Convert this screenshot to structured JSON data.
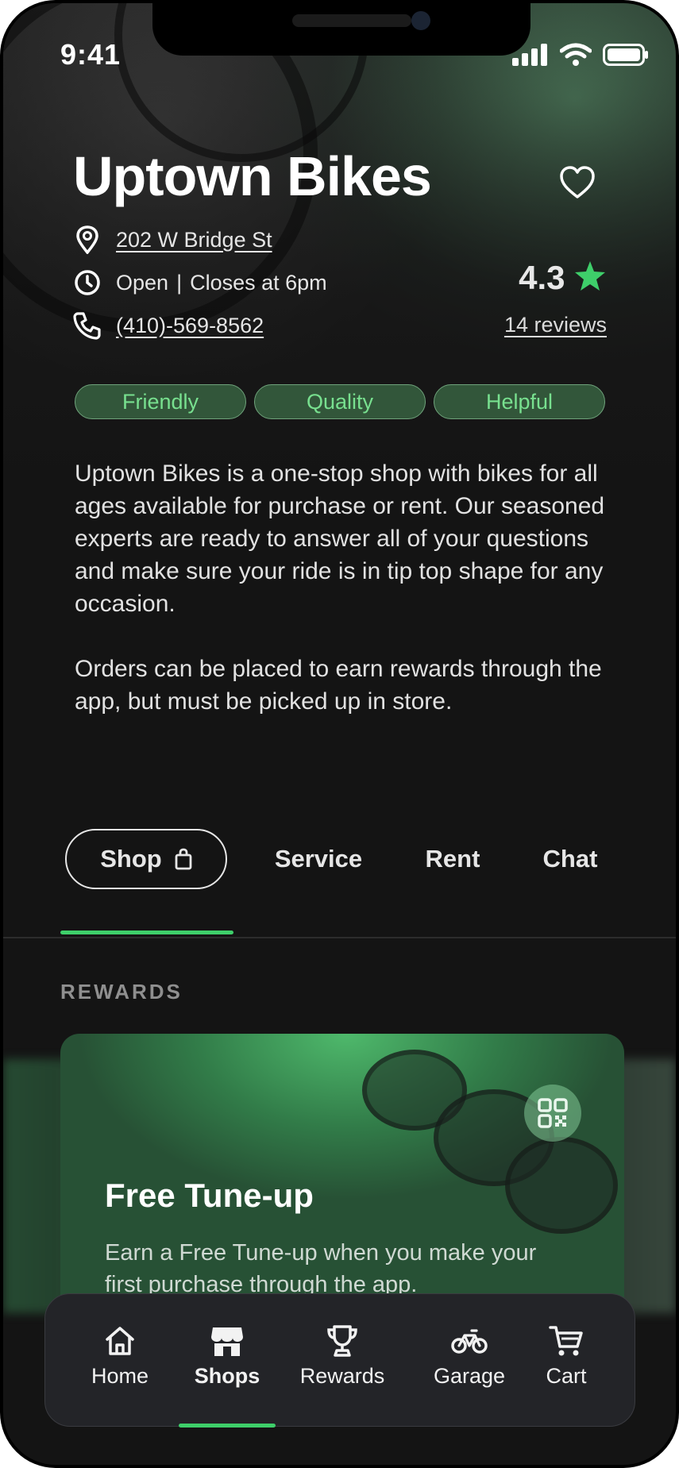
{
  "status": {
    "time": "9:41"
  },
  "shop": {
    "name": "Uptown Bikes",
    "address": "202 W Bridge St",
    "hours_status": "Open",
    "hours_separator": "|",
    "hours_close": "Closes at 6pm",
    "phone": "(410)-569-8562",
    "rating": "4.3",
    "reviews": "14 reviews",
    "tags": [
      "Friendly",
      "Quality",
      "Helpful"
    ],
    "description_1": "Uptown Bikes is a one-stop shop  with bikes for all ages available for purchase or rent. Our seasoned experts are ready to answer all of your questions and make sure your ride is in tip top shape for any occasion.",
    "description_2": "Orders can be placed to earn rewards through the app, but must be picked up in store."
  },
  "tabs": {
    "items": [
      {
        "label": "Shop",
        "active": true
      },
      {
        "label": "Service"
      },
      {
        "label": "Rent"
      },
      {
        "label": "Chat"
      }
    ]
  },
  "rewards": {
    "section_label": "REWARDS",
    "card_title": "Free Tune-up",
    "card_description": "Earn a Free Tune-up when you make your first purchase through the app."
  },
  "nav": {
    "items": [
      {
        "label": "Home",
        "icon": "home-icon"
      },
      {
        "label": "Shops",
        "icon": "storefront-icon",
        "active": true
      },
      {
        "label": "Rewards",
        "icon": "trophy-icon"
      },
      {
        "label": "Garage",
        "icon": "bicycle-icon"
      },
      {
        "label": "Cart",
        "icon": "cart-icon"
      }
    ]
  },
  "colors": {
    "accent_green": "#3ecf6a",
    "tag_text": "#78e08f",
    "background": "#141414",
    "tabbar": "#232428"
  }
}
